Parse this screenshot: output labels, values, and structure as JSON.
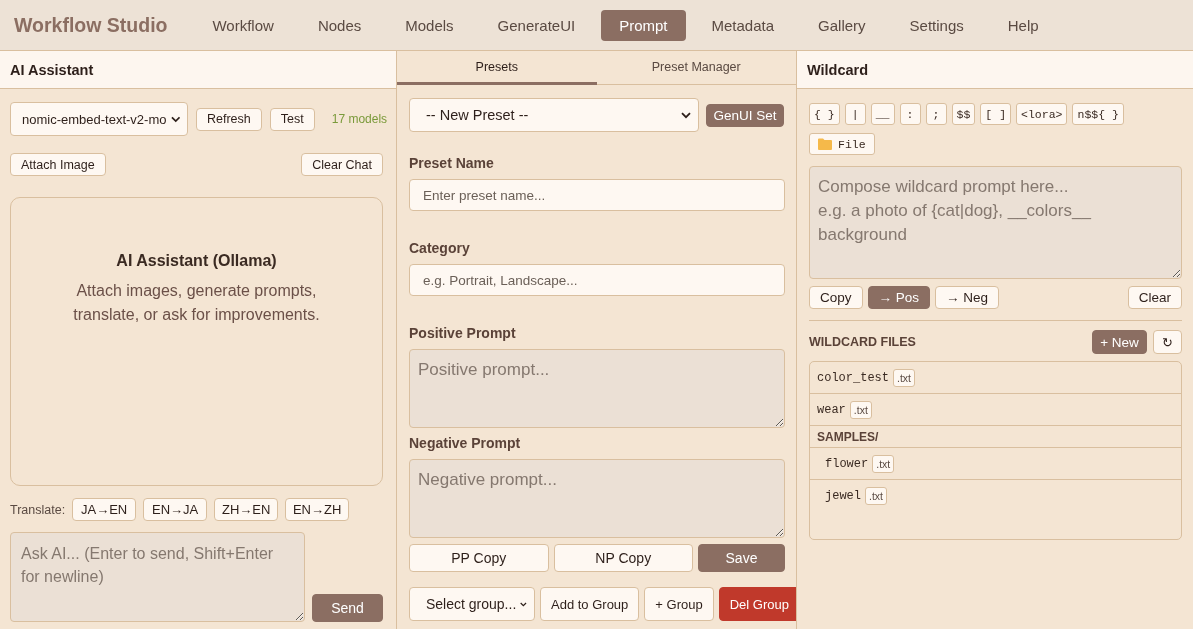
{
  "app": {
    "title": "Workflow Studio"
  },
  "nav": [
    {
      "label": "Workflow",
      "selected": false
    },
    {
      "label": "Nodes",
      "selected": false
    },
    {
      "label": "Models",
      "selected": false
    },
    {
      "label": "GenerateUI",
      "selected": false
    },
    {
      "label": "Prompt",
      "selected": true
    },
    {
      "label": "Metadata",
      "selected": false
    },
    {
      "label": "Gallery",
      "selected": false
    },
    {
      "label": "Settings",
      "selected": false
    },
    {
      "label": "Help",
      "selected": false
    }
  ],
  "ai_assistant": {
    "title": "AI Assistant",
    "model_select": {
      "value": "nomic-embed-text-v2-mo"
    },
    "model_buttons": [
      "Refresh",
      "Test"
    ],
    "model_count": "17 models",
    "attach_button": "Attach Image",
    "clear_button": "Clear Chat",
    "chat": {
      "title": "AI Assistant (Ollama)",
      "text": "Attach images, generate prompts, translate, or ask for improvements."
    },
    "translate": {
      "label": "Translate:",
      "buttons": [
        "JA→EN",
        "EN→JA",
        "ZH→EN",
        "EN→ZH"
      ]
    },
    "input": {
      "placeholder": "Ask AI... (Enter to send, Shift+Enter for newline)"
    },
    "send_button": "Send"
  },
  "presets": {
    "tabs": [
      {
        "label": "Presets",
        "selected": true
      },
      {
        "label": "Preset Manager",
        "selected": false
      }
    ],
    "preset_select": {
      "value": "-- New Preset --"
    },
    "genui_button": "GenUI Set",
    "fields": [
      {
        "kind": "input",
        "label": "Preset Name",
        "placeholder": "Enter preset name..."
      },
      {
        "kind": "input",
        "label": "Category",
        "placeholder": "e.g. Portrait, Landscape..."
      },
      {
        "kind": "textarea",
        "label": "Positive Prompt",
        "placeholder": "Positive prompt..."
      },
      {
        "kind": "textarea",
        "label": "Negative Prompt",
        "placeholder": "Negative prompt..."
      }
    ],
    "actions": [
      {
        "kind": "plain",
        "label": "PP Copy"
      },
      {
        "kind": "plain",
        "label": "NP Copy"
      },
      {
        "kind": "primary",
        "label": "Save"
      }
    ],
    "group_select": {
      "value": "Select group..."
    },
    "group_actions": [
      {
        "kind": "plain",
        "label": "Add to Group"
      },
      {
        "kind": "plain",
        "label": "+ Group"
      },
      {
        "kind": "danger",
        "label": "Del Group"
      }
    ]
  },
  "wildcard": {
    "title": "Wildcard",
    "tokens": [
      "{ }",
      "|",
      "__",
      ":",
      ";",
      "$$",
      "[ ]",
      "<lora>",
      "n$${ }"
    ],
    "file_button": "File",
    "editor": {
      "placeholder": "Compose wildcard prompt here...\ne.g. a photo of {cat|dog}, __colors__ background"
    },
    "actions": [
      {
        "kind": "plain",
        "label": "Copy"
      },
      {
        "kind": "primary",
        "label": "→ Pos"
      },
      {
        "kind": "plain",
        "label": "→ Neg"
      }
    ],
    "clear_button": "Clear",
    "files_title": "WILDCARD FILES",
    "new_button": "+ New",
    "refresh_button": "↻",
    "files": [
      {
        "kind": "file",
        "name": "color_test",
        "ext": ".txt"
      },
      {
        "kind": "file",
        "name": "wear",
        "ext": ".txt"
      },
      {
        "kind": "folder",
        "name": "SAMPLES/",
        "children": [
          {
            "kind": "file",
            "name": "flower",
            "ext": ".txt"
          },
          {
            "kind": "file",
            "name": "jewel",
            "ext": ".txt"
          }
        ]
      }
    ]
  }
}
